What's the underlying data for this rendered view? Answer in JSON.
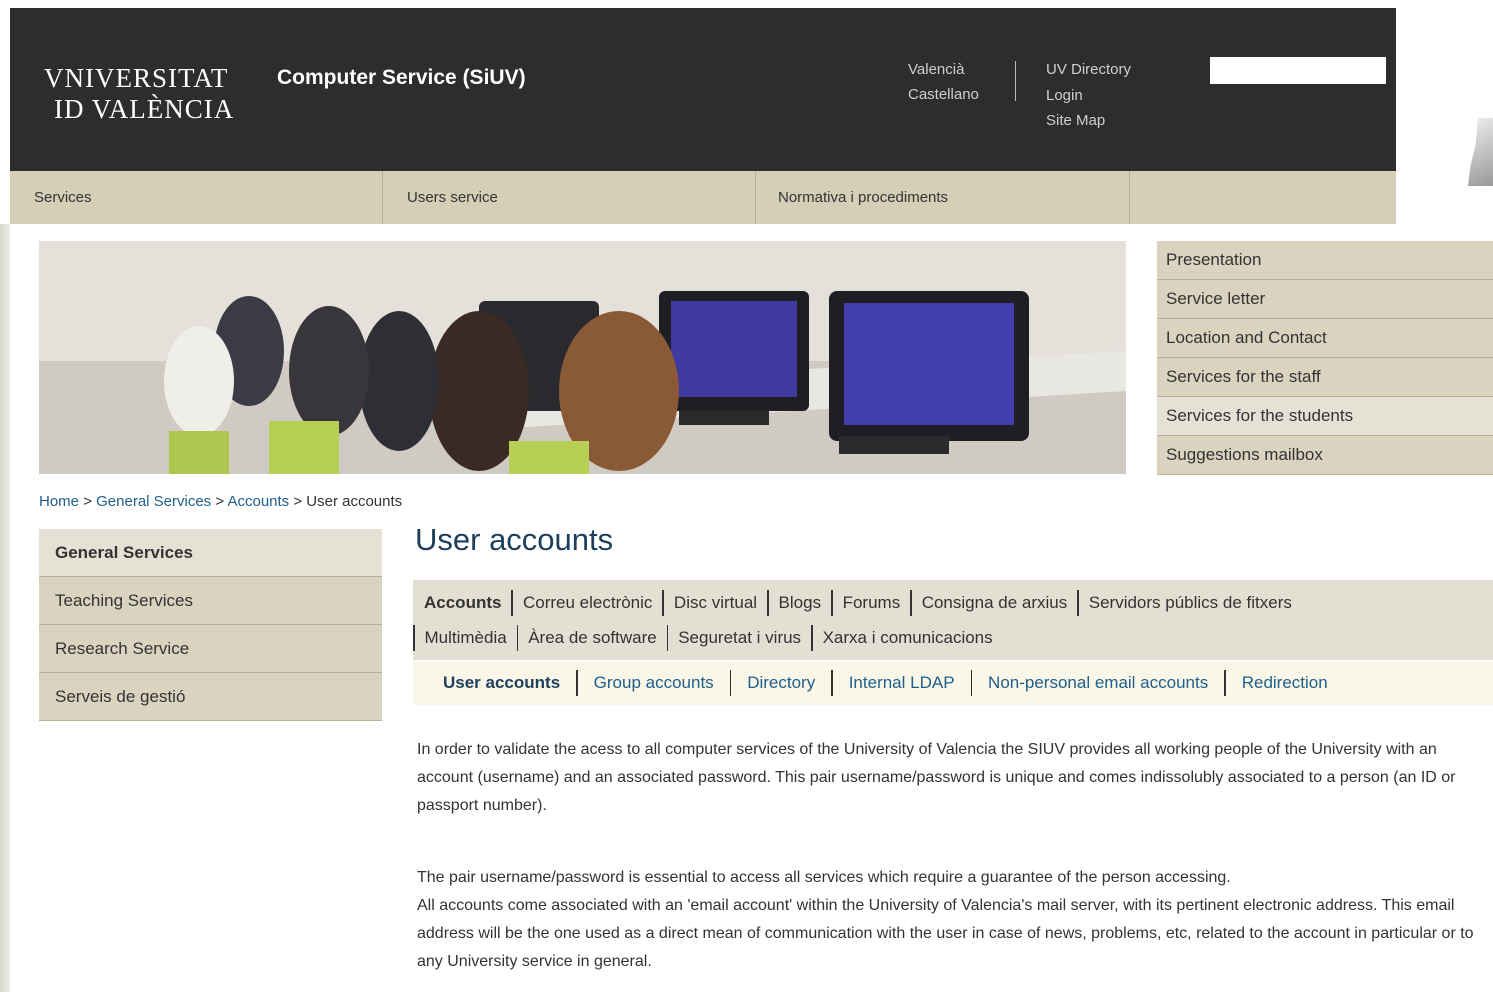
{
  "header": {
    "logo_line1": "VNIVERSITAT",
    "logo_line2": "ID VALÈNCIA",
    "site_title": "Computer Service (SiUV)",
    "languages": [
      "Valencià",
      "Castellano"
    ],
    "links": [
      "UV Directory",
      "Login",
      "Site Map"
    ],
    "search_value": ""
  },
  "main_nav": [
    "Services",
    "Users service",
    "Normativa i procediments"
  ],
  "side_menu": [
    {
      "label": "Presentation"
    },
    {
      "label": "Service letter"
    },
    {
      "label": "Location and Contact"
    },
    {
      "label": "Services for the staff"
    },
    {
      "label": "Services for the students"
    },
    {
      "label": "Suggestions mailbox"
    }
  ],
  "breadcrumb": {
    "items": [
      "Home",
      "General Services",
      "Accounts"
    ],
    "separator": ">",
    "current": "User accounts"
  },
  "left_menu": [
    {
      "label": "General Services"
    },
    {
      "label": "Teaching Services"
    },
    {
      "label": "Research Service"
    },
    {
      "label": "Serveis de gestió"
    }
  ],
  "page_title": "User accounts",
  "tabs_primary": [
    "Accounts",
    "Correu electrònic",
    "Disc virtual",
    "Blogs",
    "Forums",
    "Consigna de arxius",
    "Servidors públics de fitxers",
    "Multimèdia",
    "Àrea de software",
    "Seguretat i virus",
    "Xarxa i comunicacions"
  ],
  "tabs_secondary": [
    "User accounts",
    "Group accounts",
    "Directory",
    "Internal LDAP",
    "Non-personal email accounts",
    "Redirection"
  ],
  "content": {
    "paragraph1": "In order to validate the acess to all computer services of the University of Valencia the SIUV provides all working people of the University with an account (username) and an associated password. This pair username/password is unique and comes indissolubly associated to a person (an ID or passport number).",
    "paragraph2": "The pair username/password is essential to access all services which require a guarantee of the person accessing.",
    "paragraph3": "All accounts come associated with an 'email account' within the University of Valencia's mail server, with its pertinent electronic address. This email address will be the one used as a direct mean of communication with the user in case of news, problems, etc, related to the account in particular or to any University service in general."
  },
  "colors": {
    "header_bg": "#2d2d2d",
    "nav_bg": "#d6cfb7",
    "link": "#1f5f8b",
    "title": "#1d3f5b"
  }
}
